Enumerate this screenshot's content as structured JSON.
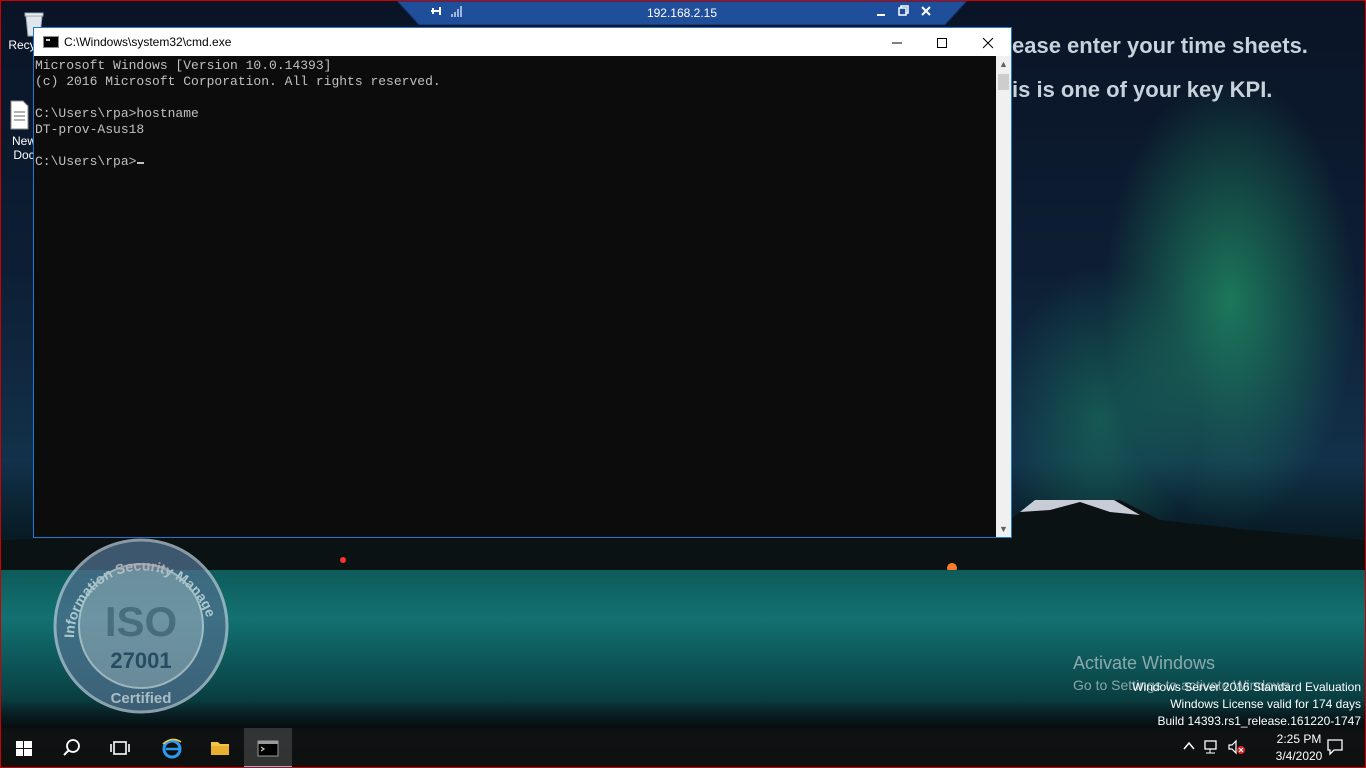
{
  "rdp_bar": {
    "ip": "192.168.2.15",
    "icons": [
      "pin-icon",
      "signal-icon",
      "minimize-icon",
      "restore-icon",
      "close-icon"
    ]
  },
  "wallpaper": {
    "line1": "ease enter your time sheets.",
    "line2": "is is one of your key KPI."
  },
  "desktop_icons": [
    {
      "label": "Recy",
      "icon": "recycle-bin-icon"
    },
    {
      "label_line1": "New",
      "label_line2": "Doc",
      "icon": "document-icon"
    }
  ],
  "seal": {
    "arc_text": "Information Security Management System",
    "center": "ISO",
    "number": "27001",
    "bottom": "Certified"
  },
  "cmd_window": {
    "title": "C:\\Windows\\system32\\cmd.exe",
    "controls": [
      "minimize",
      "maximize",
      "close"
    ],
    "lines": [
      "Microsoft Windows [Version 10.0.14393]",
      "(c) 2016 Microsoft Corporation. All rights reserved.",
      "",
      "C:\\Users\\rpa>hostname",
      "DT-prov-Asus18",
      "",
      "C:\\Users\\rpa>"
    ]
  },
  "activation": {
    "title": "Activate Windows",
    "subtitle": "Go to Settings to activate Windows."
  },
  "server_info": {
    "line1": "Windows Server 2016 Standard Evaluation",
    "line2": "Windows License valid for 174 days",
    "line3": "Build 14393.rs1_release.161220-1747"
  },
  "taskbar": {
    "items": [
      "start-icon",
      "search-icon",
      "task-view-icon",
      "internet-explorer-icon",
      "file-explorer-icon",
      "cmd-icon"
    ],
    "tray": [
      "chevron-up-icon",
      "network-icon",
      "volume-muted-icon"
    ],
    "time": "2:25 PM",
    "date": "3/4/2020"
  },
  "colors": {
    "accent": "#1f78d1",
    "console_bg": "#0c0c0c",
    "console_fg": "#c0c0c0",
    "rdp_bar": "#1f4f9a"
  }
}
